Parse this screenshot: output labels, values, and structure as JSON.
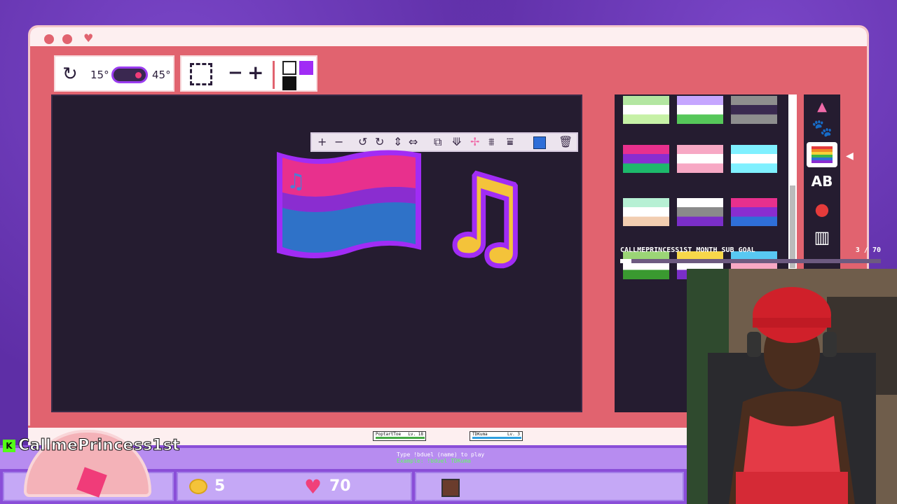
{
  "window": {
    "controls": [
      "close-dot",
      "minimize-dot",
      "heart"
    ]
  },
  "tools": {
    "rotate_min_label": "15°",
    "rotate_max_label": "45°",
    "minus_label": "−",
    "plus_label": "+"
  },
  "colors": {
    "background": "#6a35b5",
    "window": "#e1636f",
    "canvas": "#251c30",
    "primary_swatch": "#a12cf5",
    "secondary_swatch": "#111111",
    "tertiary_swatch": "#ffffff",
    "toolbar_color": "#2f6fd8"
  },
  "canvas_toolbar": {
    "icons": [
      "zoom-in-icon",
      "zoom-out-icon",
      "rotate-left-icon",
      "rotate-right-icon",
      "flip-vertical-icon",
      "flip-horizontal-icon",
      "duplicate-icon",
      "layer-down-icon",
      "layer-up-icon",
      "send-back-icon",
      "bring-front-icon",
      "color-swatch",
      "trash-icon"
    ],
    "glyphs": [
      "+",
      "−",
      "↺",
      "↻",
      "⇕",
      "⇔",
      "⧉",
      "⟱",
      "✢",
      "⩩",
      "⩸",
      "",
      "🗑"
    ]
  },
  "stickers": [
    {
      "name": "bi-music-flag"
    },
    {
      "name": "music-notes"
    }
  ],
  "sidebar": {
    "categories": [
      "up-arrow-icon",
      "paw-icon",
      "rainbow-flag-icon",
      "text-ab-icon",
      "apple-icon",
      "piano-icon"
    ],
    "active_category": "rainbow-flag-icon",
    "flags": [
      [
        "#b3e6a1",
        "#ffffff",
        "#c6f1a6"
      ],
      [
        "#c5a6ff",
        "#ffffff",
        "#56c75a"
      ],
      [
        "#8e8e8e",
        "#3a2a50",
        "#8e8e8e"
      ],
      [
        "#e8308d",
        "#8a2dd0",
        "#1db86b"
      ],
      [
        "#f7a8c4",
        "#ffffff",
        "#f7a8c4"
      ],
      [
        "#7ff0ff",
        "#ffffff",
        "#7ff0ff"
      ],
      [
        "#b7f0d4",
        "#ffffff",
        "#f2cdb0"
      ],
      [
        "#ffffff",
        "#8a8a8a",
        "#7a2ec8"
      ],
      [
        "#e8308d",
        "#8a2dd0",
        "#2f6fd8"
      ],
      [
        "#9bd576",
        "#ffffff",
        "#3a9a30"
      ],
      [
        "#f7d74a",
        "#ffffff",
        "#7a2ec8"
      ],
      [
        "#58c8f2",
        "#f7a8c4",
        "#ffffff"
      ]
    ]
  },
  "goal": {
    "title": "CALLMEPRINCESS1ST MONTH SUB GOAL",
    "count": "3 / 70",
    "progress": 0.043
  },
  "players": [
    {
      "name": "PoptartToe",
      "level": "Lv. 18"
    },
    {
      "name": "TDKuma",
      "level": "Lv. 3"
    }
  ],
  "hint": {
    "line1": "Type !bduel (name) to play",
    "line2": "Example: !bduel TDKuma"
  },
  "stats": {
    "coins": "5",
    "hearts": "70"
  },
  "streamer": {
    "username": "CallmePrincess1st",
    "platform_badge": "K"
  }
}
